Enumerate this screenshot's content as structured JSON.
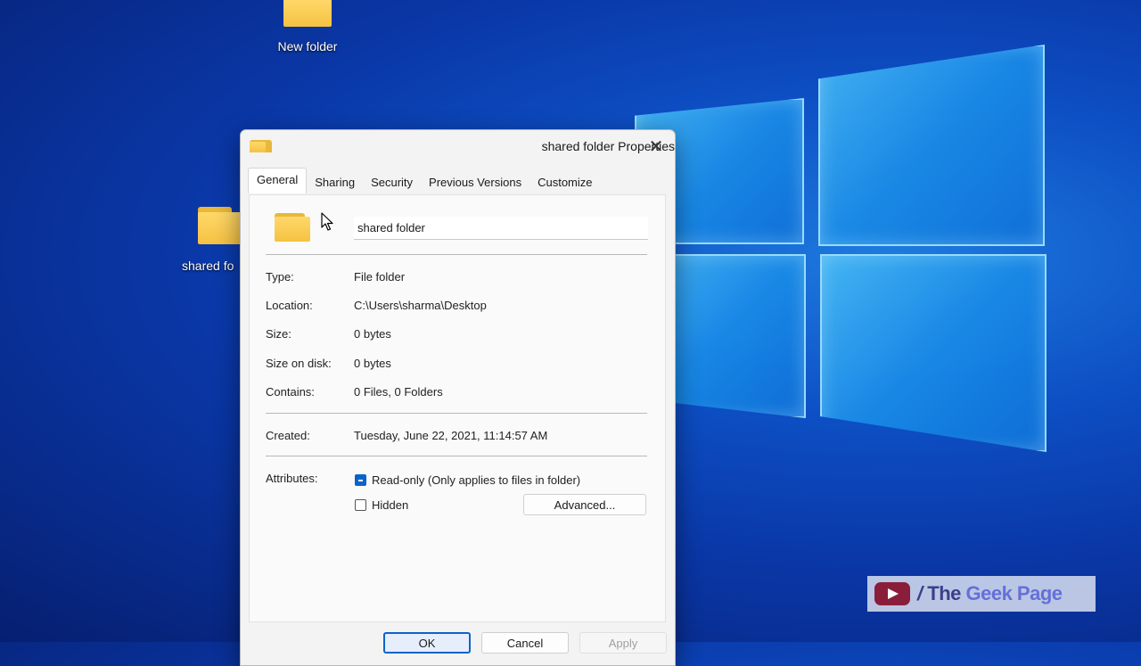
{
  "desktop": {
    "icons": [
      {
        "label": "New folder"
      },
      {
        "label": "shared fo"
      }
    ]
  },
  "dialog": {
    "title": "shared folder Properties",
    "close_glyph": "✕",
    "tabs": [
      {
        "label": "General",
        "active": true
      },
      {
        "label": "Sharing"
      },
      {
        "label": "Security"
      },
      {
        "label": "Previous Versions"
      },
      {
        "label": "Customize"
      }
    ],
    "name_value": "shared folder",
    "properties": [
      {
        "label": "Type:",
        "value": "File folder"
      },
      {
        "label": "Location:",
        "value": "C:\\Users\\sharma\\Desktop"
      },
      {
        "label": "Size:",
        "value": "0 bytes"
      },
      {
        "label": "Size on disk:",
        "value": "0 bytes"
      },
      {
        "label": "Contains:",
        "value": "0 Files, 0 Folders"
      }
    ],
    "created": {
      "label": "Created:",
      "value": "Tuesday, June 22, 2021, 11:14:57 AM"
    },
    "attributes": {
      "label": "Attributes:",
      "readonly_label": "Read-only (Only applies to files in folder)",
      "readonly_state": "indeterminate",
      "hidden_label": "Hidden",
      "hidden_checked": false,
      "advanced_label": "Advanced..."
    },
    "buttons": {
      "ok": "OK",
      "cancel": "Cancel",
      "apply": "Apply"
    }
  },
  "watermark": {
    "slash": "/",
    "the": "The",
    "geek_page": "Geek Page"
  },
  "colors": {
    "accent": "#0a64c8",
    "folder": "#f5c242",
    "desktop": "#0a38a8"
  }
}
